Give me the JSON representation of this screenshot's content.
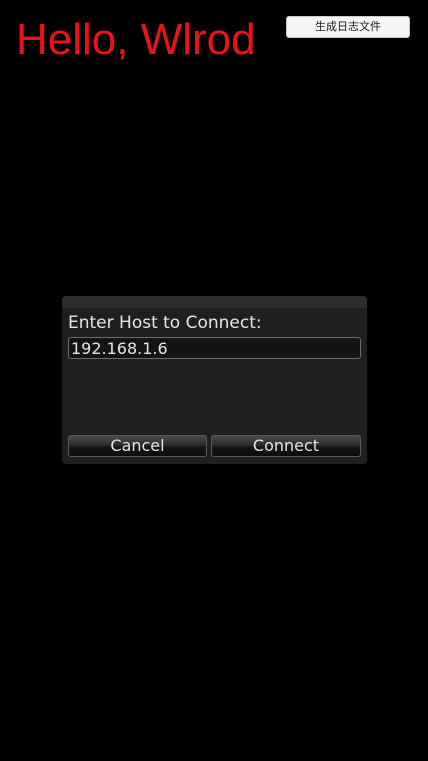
{
  "header": {
    "title": "Hello, Wlrod",
    "log_button_label": "生成日志文件"
  },
  "dialog": {
    "prompt": "Enter Host to Connect:",
    "host_value": "192.168.1.6",
    "cancel_label": "Cancel",
    "connect_label": "Connect"
  },
  "colors": {
    "background": "#000000",
    "title_text": "#e8141b",
    "dialog_bg": "#1f1f1f"
  }
}
